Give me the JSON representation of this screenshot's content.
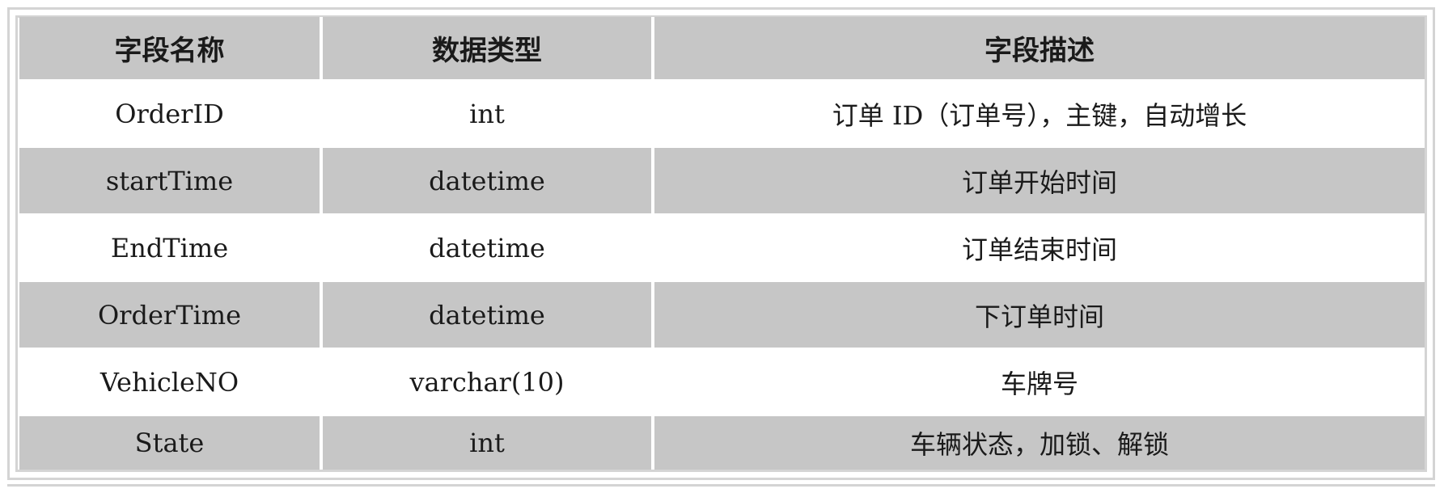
{
  "table": {
    "headers": [
      "字段名称",
      "数据类型",
      "字段描述"
    ],
    "rows": [
      [
        "OrderID",
        "int",
        "订单 ID（订单号），主键，自动增长"
      ],
      [
        "startTime",
        "datetime",
        "订单开始时间"
      ],
      [
        "EndTime",
        "datetime",
        "订单结束时间"
      ],
      [
        "OrderTime",
        "datetime",
        "下订单时间"
      ],
      [
        "VehicleNO",
        "varchar(10)",
        "车牌号"
      ],
      [
        "State",
        "int",
        "车辆状态，加锁、解锁"
      ]
    ]
  },
  "colors": {
    "header_bg": "#c6c6c6",
    "stripe_bg": "#c6c6c6",
    "plain_bg": "#ffffff",
    "frame": "#d4d4d4"
  }
}
